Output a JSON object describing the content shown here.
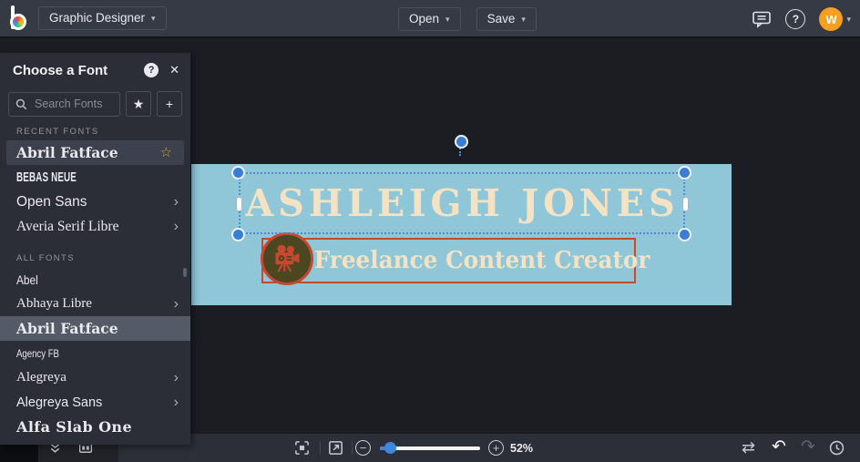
{
  "header": {
    "app_menu_label": "Graphic Designer",
    "open_label": "Open",
    "save_label": "Save",
    "avatar_initial": "W"
  },
  "icons": {
    "chevron_down": "▾",
    "chevron_right": "›",
    "help_glyph": "?",
    "close_glyph": "✕",
    "star_filled": "★",
    "star_outline": "☆",
    "plus_glyph": "+",
    "minus_glyph": "−",
    "swap_glyph": "⇄",
    "undo_glyph": "↶",
    "redo_glyph": "↷"
  },
  "font_panel": {
    "title": "Choose a Font",
    "search_placeholder": "Search Fonts",
    "recent_section_label": "RECENT FONTS",
    "all_section_label": "ALL FONTS",
    "recent_fonts": [
      {
        "name": "Abril Fatface"
      },
      {
        "name": "Bebas Neue"
      },
      {
        "name": "Open Sans"
      },
      {
        "name": "Averia Serif Libre"
      }
    ],
    "all_fonts": [
      {
        "name": "Abel"
      },
      {
        "name": "Abhaya Libre"
      },
      {
        "name": "Abril Fatface"
      },
      {
        "name": "Agency FB"
      },
      {
        "name": "Alegreya"
      },
      {
        "name": "Alegreya Sans"
      },
      {
        "name": "Alfa Slab One"
      }
    ]
  },
  "canvas": {
    "title_text": "ASHLEIGH JONES",
    "subtitle_text": "Freelance Content Creator",
    "colors": {
      "banner_background": "#8fc6d8",
      "text_cream": "#f3e2c4",
      "accent_red": "#c4492f",
      "badge_olive": "#4b4721",
      "selection_blue": "#3f7fd0"
    }
  },
  "footer": {
    "zoom_percent": "52%"
  }
}
